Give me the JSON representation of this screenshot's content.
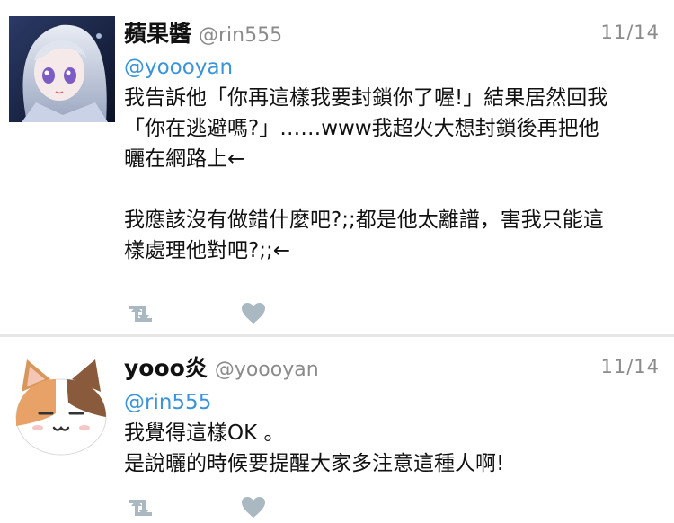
{
  "tweets": [
    {
      "display_name": "蘋果醬",
      "handle": "@rin555",
      "date": "11/14",
      "body_lines": [
        "@yoooyan",
        "我告訴他「你再這樣我要封鎖你了喔!」結果居然回我",
        "「你在逃避嗎?」……www我超火大想封鎖後再把他",
        "曬在網路上←",
        "",
        "我應該沒有做錯什麼吧?;;都是他太離譜，害我只能這",
        "樣處理他對吧?;;←"
      ],
      "icons": {
        "avatar": "anime-girl-avatar",
        "retweet": "retweet-icon",
        "like": "heart-icon"
      }
    },
    {
      "display_name": "yooo炎",
      "handle": "@yoooyan",
      "date": "11/14",
      "body_lines": [
        "@rin555",
        "我覺得這樣OK 。",
        "是說曬的時候要提醒大家多注意這種人啊!"
      ],
      "icons": {
        "avatar": "cat-avatar",
        "retweet": "retweet-icon",
        "like": "heart-icon"
      }
    }
  ],
  "colors": {
    "mention": "#3b94d9",
    "meta": "#8b8b8b",
    "icon": "#aab8c2"
  }
}
